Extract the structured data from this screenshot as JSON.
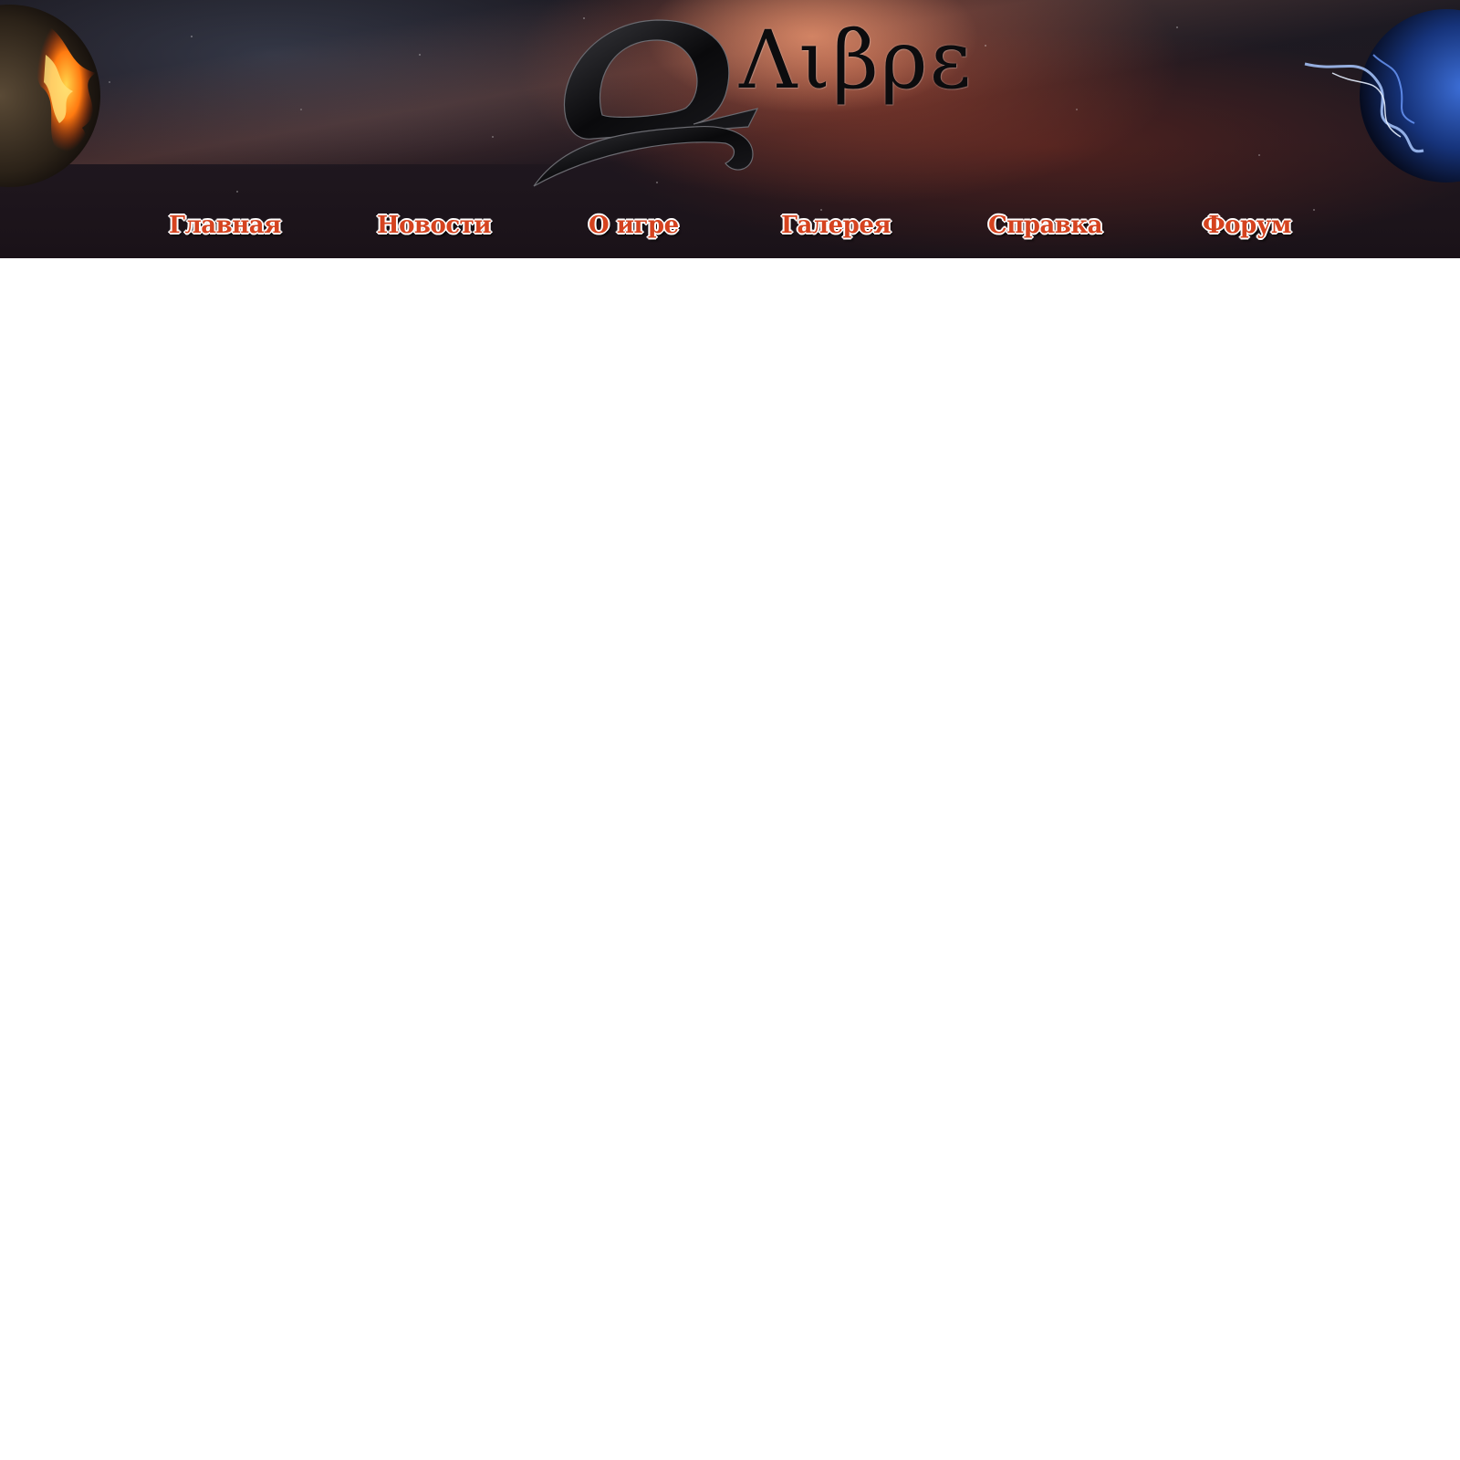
{
  "header": {
    "logo_text": "Λιβρε",
    "logo_icon": "libra-symbol-icon",
    "left_decoration": "fire-planet-icon",
    "right_decoration": "ice-planet-icon"
  },
  "nav": {
    "items": [
      {
        "label": "Главная"
      },
      {
        "label": "Новости"
      },
      {
        "label": "О игре"
      },
      {
        "label": "Галерея"
      },
      {
        "label": "Справка"
      },
      {
        "label": "Форум"
      }
    ]
  },
  "colors": {
    "nav_text": "#d5431f",
    "nav_outline": "#ffffff",
    "page_background": "#ffffff"
  }
}
